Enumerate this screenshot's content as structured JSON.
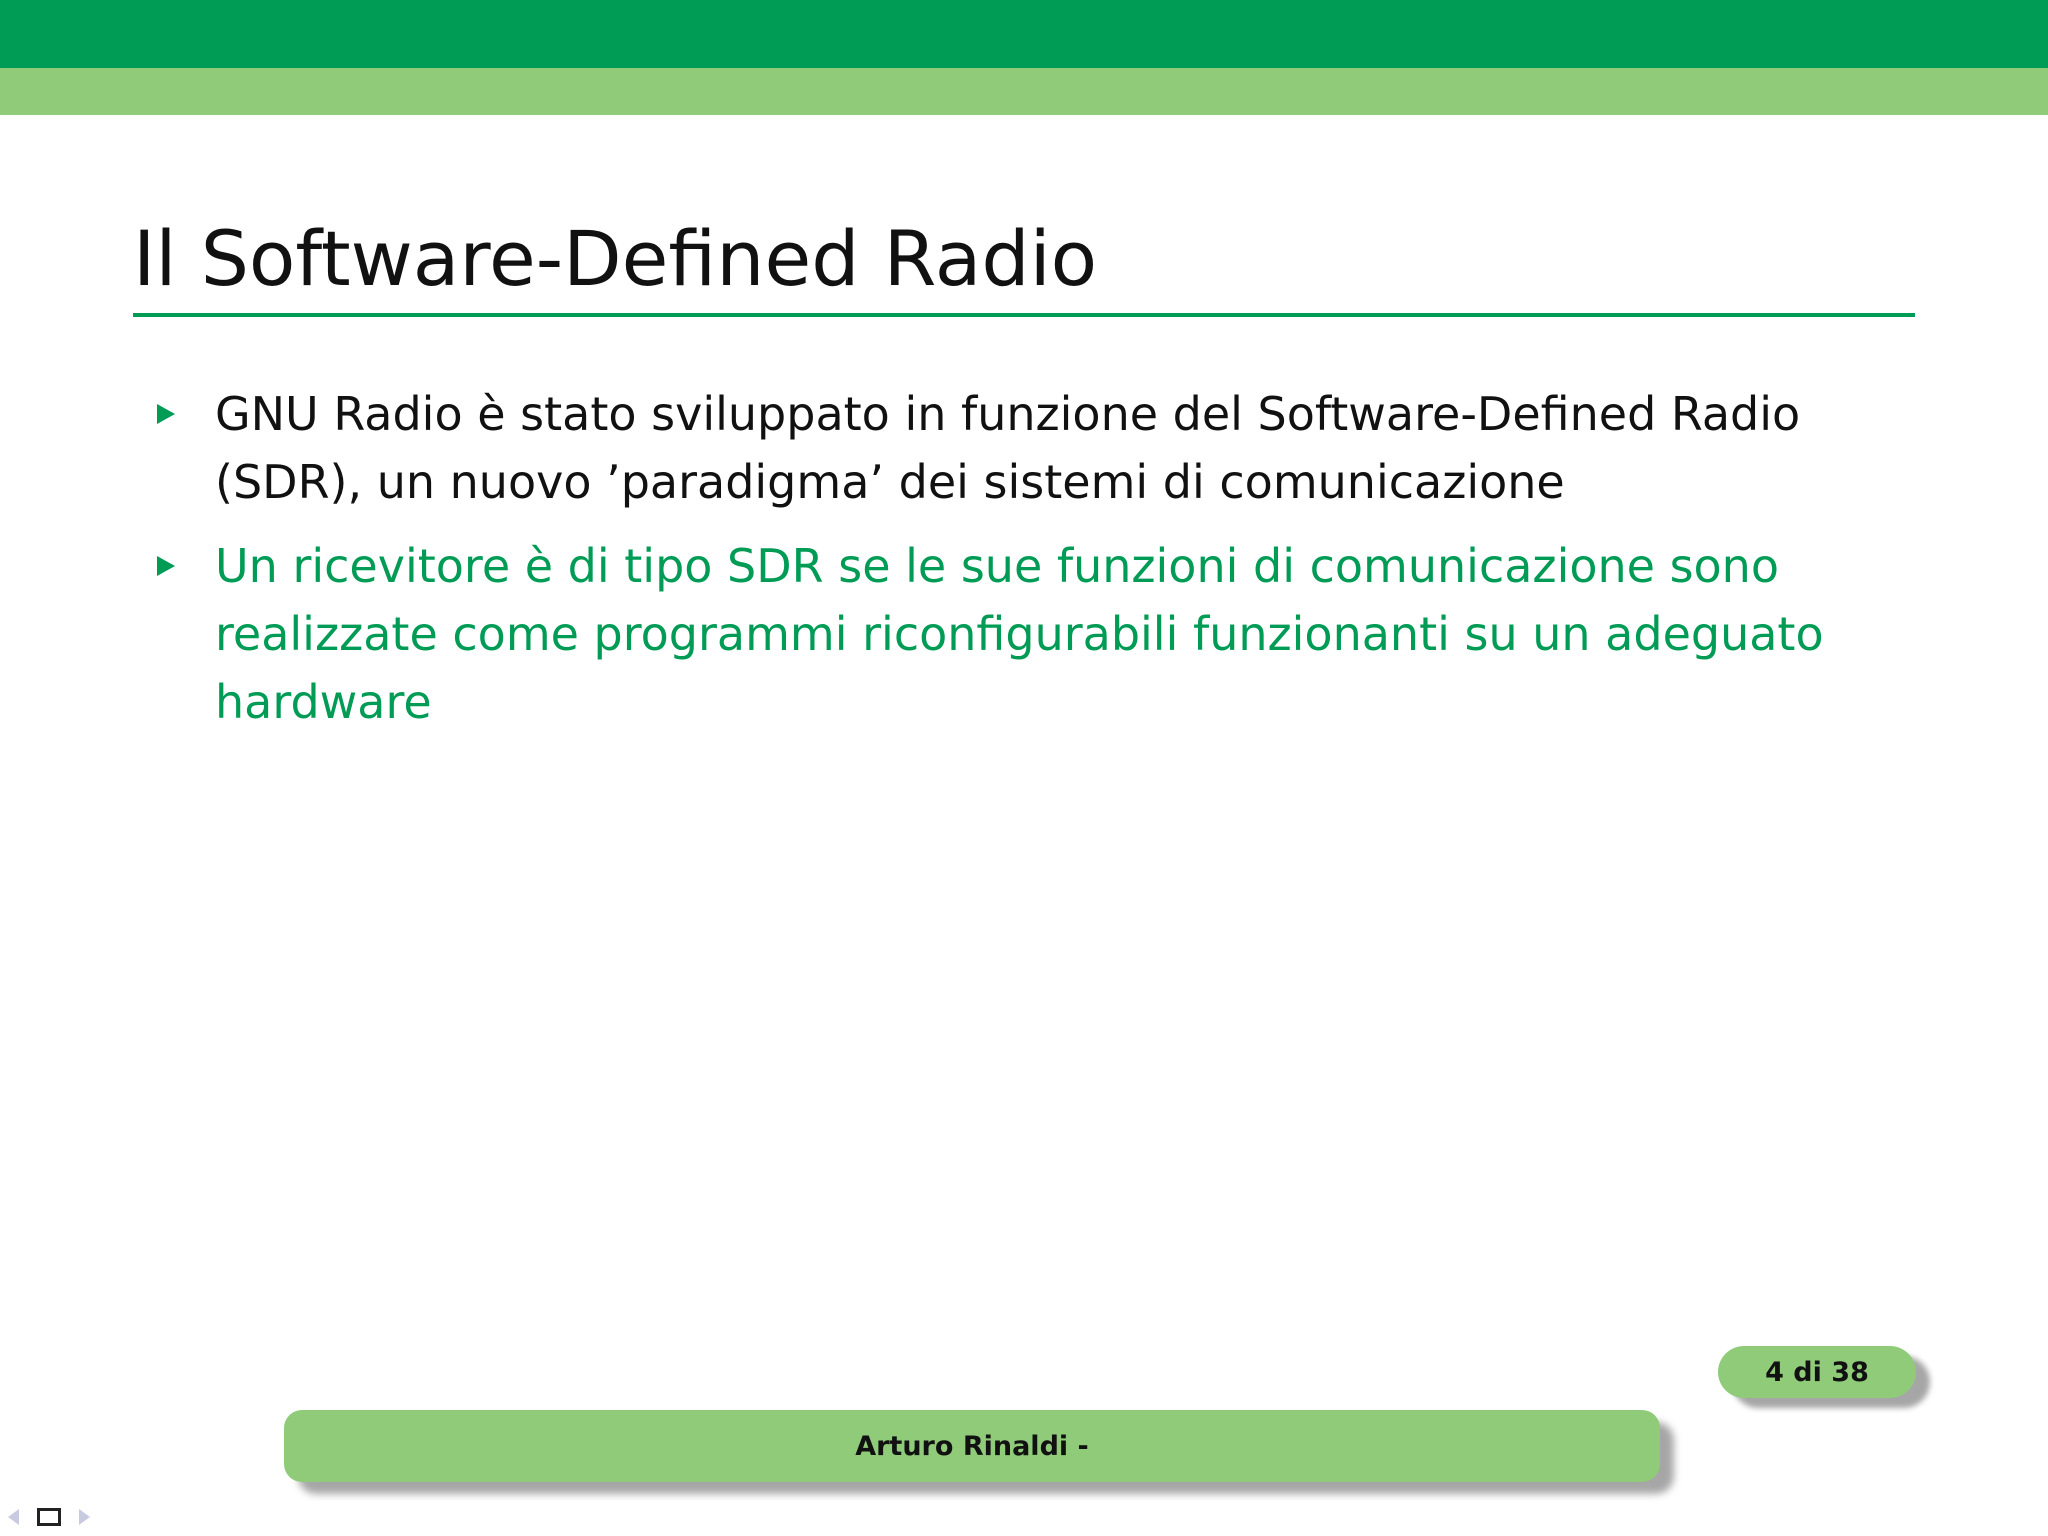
{
  "slide": {
    "title": "Il Software-Defined Radio",
    "bullets": [
      {
        "text": "GNU Radio è stato sviluppato in funzione del Software-Defined Radio (SDR), un nuovo ’paradigma’ dei sistemi di comunicazione",
        "color": "#111111"
      },
      {
        "text": "Un ricevitore è di tipo SDR se le sue funzioni di comunicazione sono realizzate come programmi riconfigurabili funzionanti su un adeguato hardware",
        "color": "#009B55"
      }
    ]
  },
  "footer": {
    "page_indicator": "4 di 38",
    "author": "Arturo Rinaldi -"
  },
  "navigation": {
    "icons": [
      "nav-prev-icon",
      "frame-icon",
      "nav-next-icon"
    ]
  },
  "theme": {
    "header_dark": "#009B55",
    "header_light": "#8FCB79",
    "accent": "#009B55"
  }
}
